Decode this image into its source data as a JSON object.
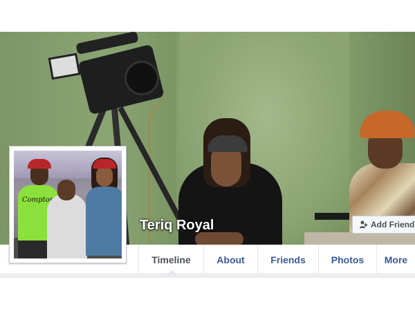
{
  "profile": {
    "name": "Teriq Royal",
    "profile_photo_text": "Compton"
  },
  "actions": {
    "add_friend_label": "Add Friend",
    "add_friend_icon": "add-friend-icon"
  },
  "nav": {
    "tabs": [
      {
        "label": "Timeline",
        "active": true
      },
      {
        "label": "About",
        "active": false
      },
      {
        "label": "Friends",
        "active": false
      },
      {
        "label": "Photos",
        "active": false
      },
      {
        "label": "More",
        "active": false
      }
    ]
  },
  "colors": {
    "link_blue": "#3b5998",
    "active_tab_text": "#4b4f56",
    "cover_green": "#8fa777"
  }
}
